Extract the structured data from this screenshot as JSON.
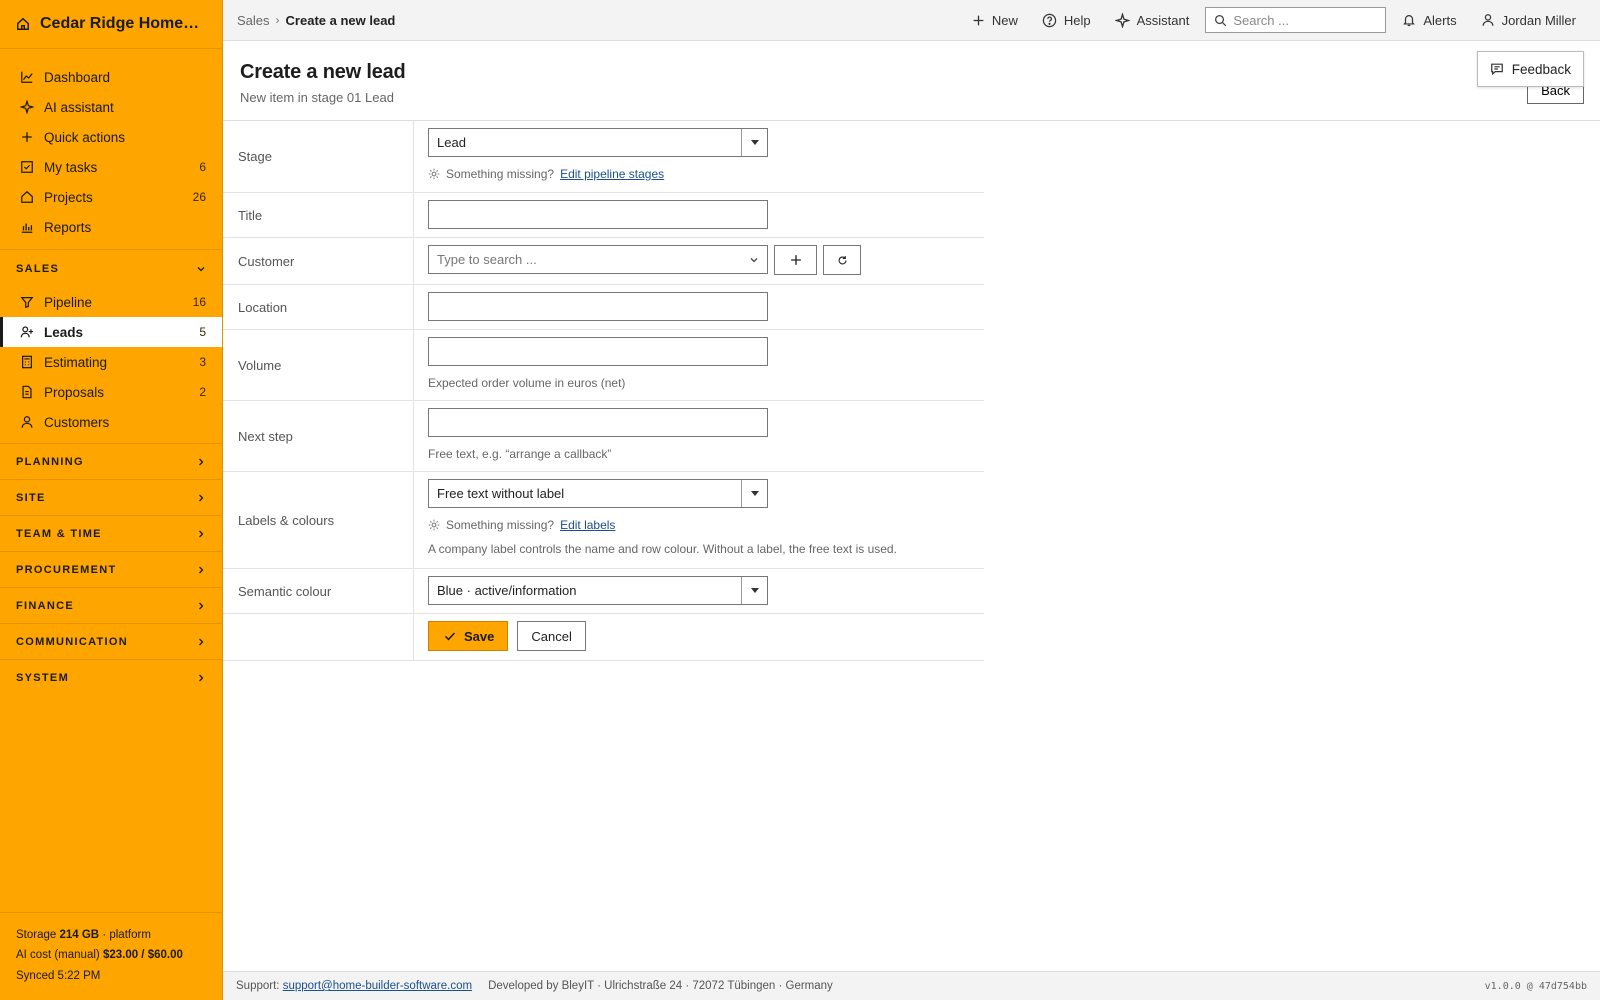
{
  "app": {
    "brand": "Cedar Ridge Homes L...",
    "colors": {
      "sidebar_bg": "#ffa500",
      "link": "#1c4f8f",
      "text": "#1b1b1b"
    }
  },
  "sidebar": {
    "main_items": [
      {
        "label": "Dashboard",
        "icon": "chart-line-icon",
        "count": ""
      },
      {
        "label": "AI assistant",
        "icon": "sparkle-icon",
        "count": ""
      },
      {
        "label": "Quick actions",
        "icon": "plus-icon",
        "count": ""
      },
      {
        "label": "My tasks",
        "icon": "checkbox-icon",
        "count": "6"
      },
      {
        "label": "Projects",
        "icon": "home-icon",
        "count": "26"
      },
      {
        "label": "Reports",
        "icon": "bar-chart-icon",
        "count": ""
      }
    ],
    "sales_section": {
      "title": "SALES",
      "items": [
        {
          "label": "Pipeline",
          "icon": "filter-icon",
          "count": "16"
        },
        {
          "label": "Leads",
          "icon": "user-plus-icon",
          "count": "5",
          "active": true
        },
        {
          "label": "Estimating",
          "icon": "calculator-icon",
          "count": "3"
        },
        {
          "label": "Proposals",
          "icon": "document-icon",
          "count": "2"
        },
        {
          "label": "Customers",
          "icon": "user-icon",
          "count": ""
        }
      ]
    },
    "collapsed_sections": [
      "PLANNING",
      "SITE",
      "TEAM & TIME",
      "PROCUREMENT",
      "FINANCE",
      "COMMUNICATION",
      "SYSTEM"
    ],
    "footer": {
      "storage_label": "Storage",
      "storage_value": "214 GB",
      "storage_suffix": "· platform",
      "ai_cost_label": "AI cost (manual)",
      "ai_cost_value": "$23.00 / $60.00",
      "synced": "Synced 5:22 PM"
    }
  },
  "topbar": {
    "breadcrumb": {
      "parent": "Sales",
      "separator": "›",
      "current": "Create a new lead"
    },
    "new_label": "New",
    "help_label": "Help",
    "assistant_label": "Assistant",
    "search_placeholder": "Search ...",
    "alerts_label": "Alerts",
    "user_name": "Jordan Miller"
  },
  "header": {
    "title": "Create a new lead",
    "subtitle": "New item in stage 01 Lead",
    "feedback_label": "Feedback",
    "back_label": "Back"
  },
  "form": {
    "stage": {
      "label": "Stage",
      "value": "Lead",
      "hint_text": "Something missing?",
      "hint_link": "Edit pipeline stages"
    },
    "title": {
      "label": "Title",
      "value": ""
    },
    "customer": {
      "label": "Customer",
      "placeholder": "Type to search ..."
    },
    "location": {
      "label": "Location",
      "value": ""
    },
    "volume": {
      "label": "Volume",
      "value": "",
      "note": "Expected order volume in euros (net)"
    },
    "next_step": {
      "label": "Next step",
      "value": "",
      "note": "Free text, e.g. “arrange a callback”"
    },
    "labels": {
      "label": "Labels & colours",
      "value": "Free text without label",
      "hint_text": "Something missing?",
      "hint_link": "Edit labels",
      "note": "A company label controls the name and row colour. Without a label, the free text is used."
    },
    "semantic_colour": {
      "label": "Semantic colour",
      "value": "Blue · active/information"
    },
    "save_label": "Save",
    "cancel_label": "Cancel"
  },
  "footer": {
    "support_label": "Support:",
    "support_email": "support@home-builder-software.com",
    "developer": "Developed by BleyIT · Ulrichstraße 24 · 72072 Tübingen · Germany",
    "version": "v1.0.0 @ 47d754bb"
  }
}
